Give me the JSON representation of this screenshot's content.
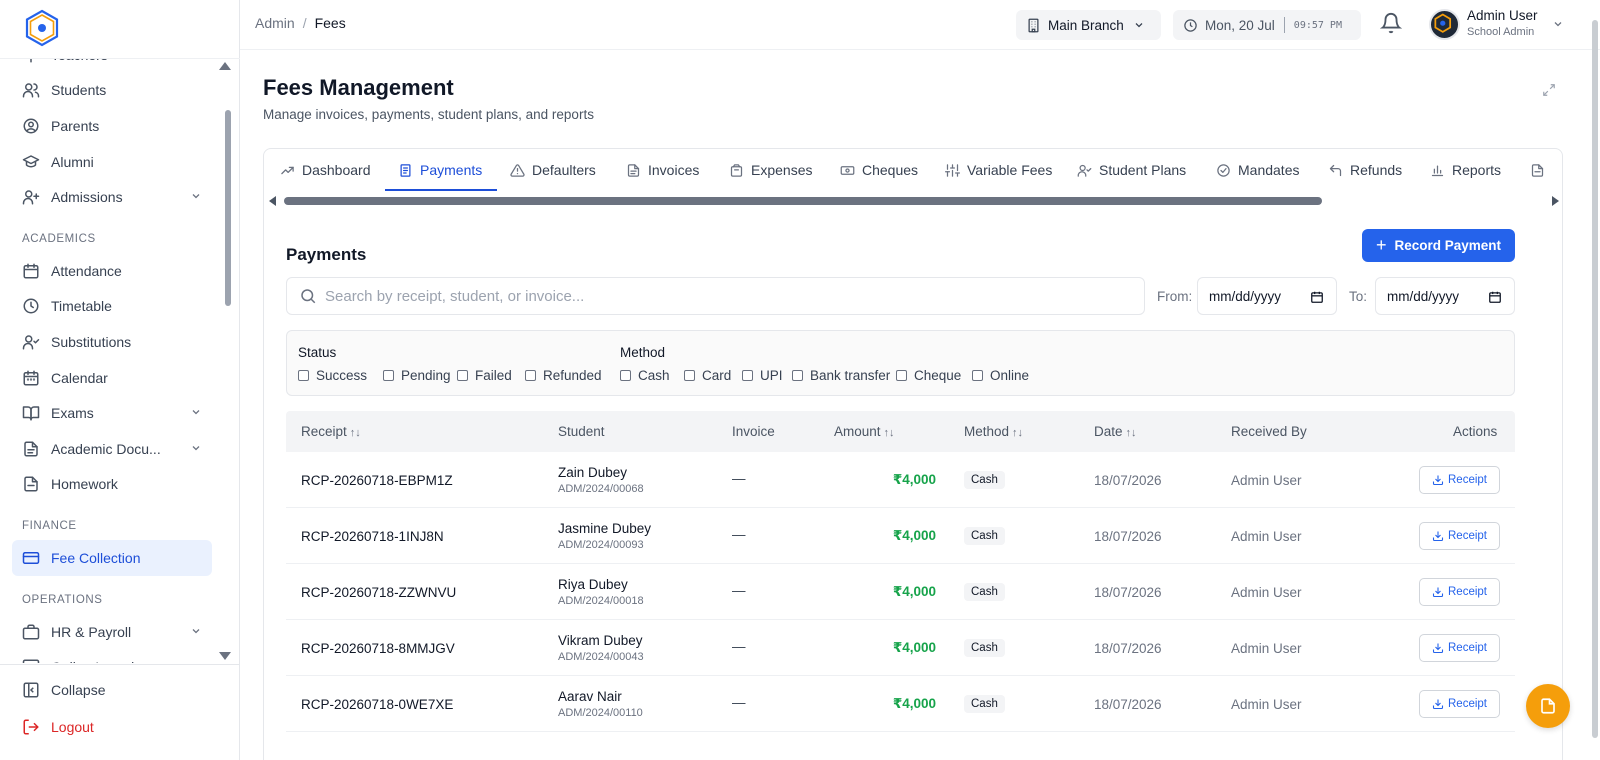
{
  "sidebar": {
    "items": [
      {
        "label": "Teachers",
        "icon": "presentation-icon"
      },
      {
        "label": "Students",
        "icon": "users-icon"
      },
      {
        "label": "Parents",
        "icon": "user-circle-icon"
      },
      {
        "label": "Alumni",
        "icon": "graduation-cap-icon"
      },
      {
        "label": "Admissions",
        "icon": "user-plus-icon",
        "expandable": true
      }
    ],
    "section_academics": "ACADEMICS",
    "academics": [
      {
        "label": "Attendance",
        "icon": "calendar-check-icon"
      },
      {
        "label": "Timetable",
        "icon": "clock-icon"
      },
      {
        "label": "Substitutions",
        "icon": "user-check-icon"
      },
      {
        "label": "Calendar",
        "icon": "calendar-icon"
      },
      {
        "label": "Exams",
        "icon": "book-open-icon",
        "expandable": true
      },
      {
        "label": "Academic Docu...",
        "icon": "file-text-icon",
        "expandable": true
      },
      {
        "label": "Homework",
        "icon": "file-icon"
      }
    ],
    "section_finance": "FINANCE",
    "finance": [
      {
        "label": "Fee Collection",
        "icon": "credit-card-icon",
        "active": true
      }
    ],
    "section_operations": "OPERATIONS",
    "operations": [
      {
        "label": "HR & Payroll",
        "icon": "briefcase-icon",
        "expandable": true
      },
      {
        "label": "Online Learning",
        "icon": "monitor-icon"
      }
    ],
    "collapse_label": "Collapse",
    "logout_label": "Logout"
  },
  "header": {
    "breadcrumb_root": "Admin",
    "breadcrumb_sep": "/",
    "breadcrumb_current": "Fees",
    "branch": "Main Branch",
    "date": "Mon, 20 Jul",
    "time": "09:57 PM",
    "user_name": "Admin User",
    "user_role": "School Admin"
  },
  "page": {
    "title": "Fees Management",
    "subtitle": "Manage invoices, payments, student plans, and reports"
  },
  "tabs": [
    {
      "label": "Dashboard",
      "icon": "trend-icon"
    },
    {
      "label": "Payments",
      "icon": "receipt-icon",
      "active": true
    },
    {
      "label": "Defaulters",
      "icon": "alert-triangle-icon"
    },
    {
      "label": "Invoices",
      "icon": "file-text-icon"
    },
    {
      "label": "Expenses",
      "icon": "wallet-icon"
    },
    {
      "label": "Cheques",
      "icon": "banknote-icon"
    },
    {
      "label": "Variable Fees",
      "icon": "sliders-icon"
    },
    {
      "label": "Student Plans",
      "icon": "user-check-icon"
    },
    {
      "label": "Mandates",
      "icon": "check-circle-icon"
    },
    {
      "label": "Refunds",
      "icon": "undo-icon"
    },
    {
      "label": "Reports",
      "icon": "bar-chart-icon"
    }
  ],
  "payments": {
    "title": "Payments",
    "record_button": "Record Payment",
    "search_placeholder": "Search by receipt, student, or invoice...",
    "from_label": "From:",
    "to_label": "To:",
    "date_placeholder": "mm/dd/yyyy",
    "status_title": "Status",
    "status_options": [
      "Success",
      "Pending",
      "Failed",
      "Refunded"
    ],
    "method_title": "Method",
    "method_options": [
      "Cash",
      "Card",
      "UPI",
      "Bank transfer",
      "Cheque",
      "Online"
    ],
    "columns": {
      "receipt": "Receipt",
      "student": "Student",
      "invoice": "Invoice",
      "amount": "Amount",
      "method": "Method",
      "date": "Date",
      "received_by": "Received By",
      "actions": "Actions"
    },
    "sort_glyph": "↑↓",
    "receipt_button": "Receipt",
    "rows": [
      {
        "receipt": "RCP-20260718-EBPM1Z",
        "student": "Zain Dubey",
        "adm": "ADM/2024/00068",
        "invoice": "—",
        "amount": "₹4,000",
        "method": "Cash",
        "date": "18/07/2026",
        "received_by": "Admin User"
      },
      {
        "receipt": "RCP-20260718-1INJ8N",
        "student": "Jasmine Dubey",
        "adm": "ADM/2024/00093",
        "invoice": "—",
        "amount": "₹4,000",
        "method": "Cash",
        "date": "18/07/2026",
        "received_by": "Admin User"
      },
      {
        "receipt": "RCP-20260718-ZZWNVU",
        "student": "Riya Dubey",
        "adm": "ADM/2024/00018",
        "invoice": "—",
        "amount": "₹4,000",
        "method": "Cash",
        "date": "18/07/2026",
        "received_by": "Admin User"
      },
      {
        "receipt": "RCP-20260718-8MMJGV",
        "student": "Vikram Dubey",
        "adm": "ADM/2024/00043",
        "invoice": "—",
        "amount": "₹4,000",
        "method": "Cash",
        "date": "18/07/2026",
        "received_by": "Admin User"
      },
      {
        "receipt": "RCP-20260718-0WE7XE",
        "student": "Aarav Nair",
        "adm": "ADM/2024/00110",
        "invoice": "—",
        "amount": "₹4,000",
        "method": "Cash",
        "date": "18/07/2026",
        "received_by": "Admin User"
      }
    ]
  },
  "colors": {
    "primary": "#2563eb",
    "success_amount": "#16a34a",
    "logout": "#dc2626",
    "fab": "#f59e0b",
    "active_nav_bg": "#eaf1fe"
  }
}
